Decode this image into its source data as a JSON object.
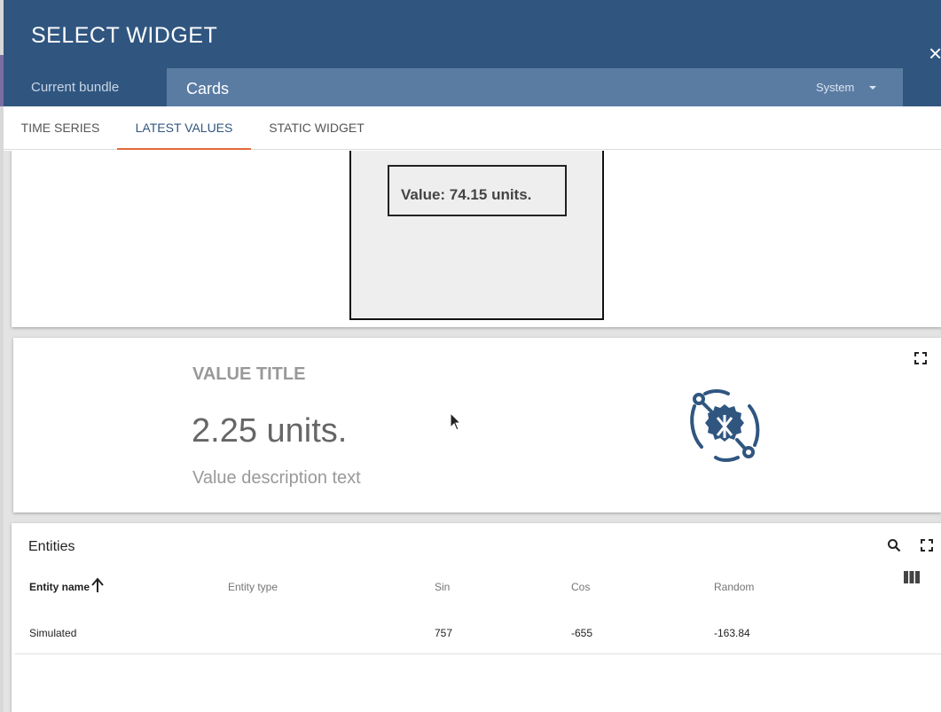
{
  "dialog": {
    "title": "SELECT WIDGET",
    "close_glyph": "×",
    "bundle_label": "Current bundle",
    "bundle_name": "Cards",
    "bundle_scope": "System"
  },
  "tabs": [
    {
      "label": "TIME SERIES",
      "active": false
    },
    {
      "label": "LATEST VALUES",
      "active": true
    },
    {
      "label": "STATIC WIDGET",
      "active": false
    }
  ],
  "cards": {
    "simple_card": {
      "value_text": "Value: 74.15 units."
    },
    "value_card": {
      "title": "VALUE TITLE",
      "value": "2.25 units.",
      "description": "Value description text",
      "icon": "bug-chip-icon"
    },
    "entities_table": {
      "title": "Entities",
      "columns": [
        "Entity name",
        "Entity type",
        "Sin",
        "Cos",
        "Random"
      ],
      "sort_column": "Entity name",
      "rows": [
        {
          "entity_name": "Simulated",
          "entity_type": "",
          "sin": "757",
          "cos": "-655",
          "random": "-163.84"
        }
      ]
    }
  },
  "colors": {
    "header_bg": "#305680",
    "bundle_select_bg": "#5a7ca3",
    "tab_active_underline": "#e26a3b",
    "tab_active_text": "#305680",
    "icon_color": "#305680"
  }
}
